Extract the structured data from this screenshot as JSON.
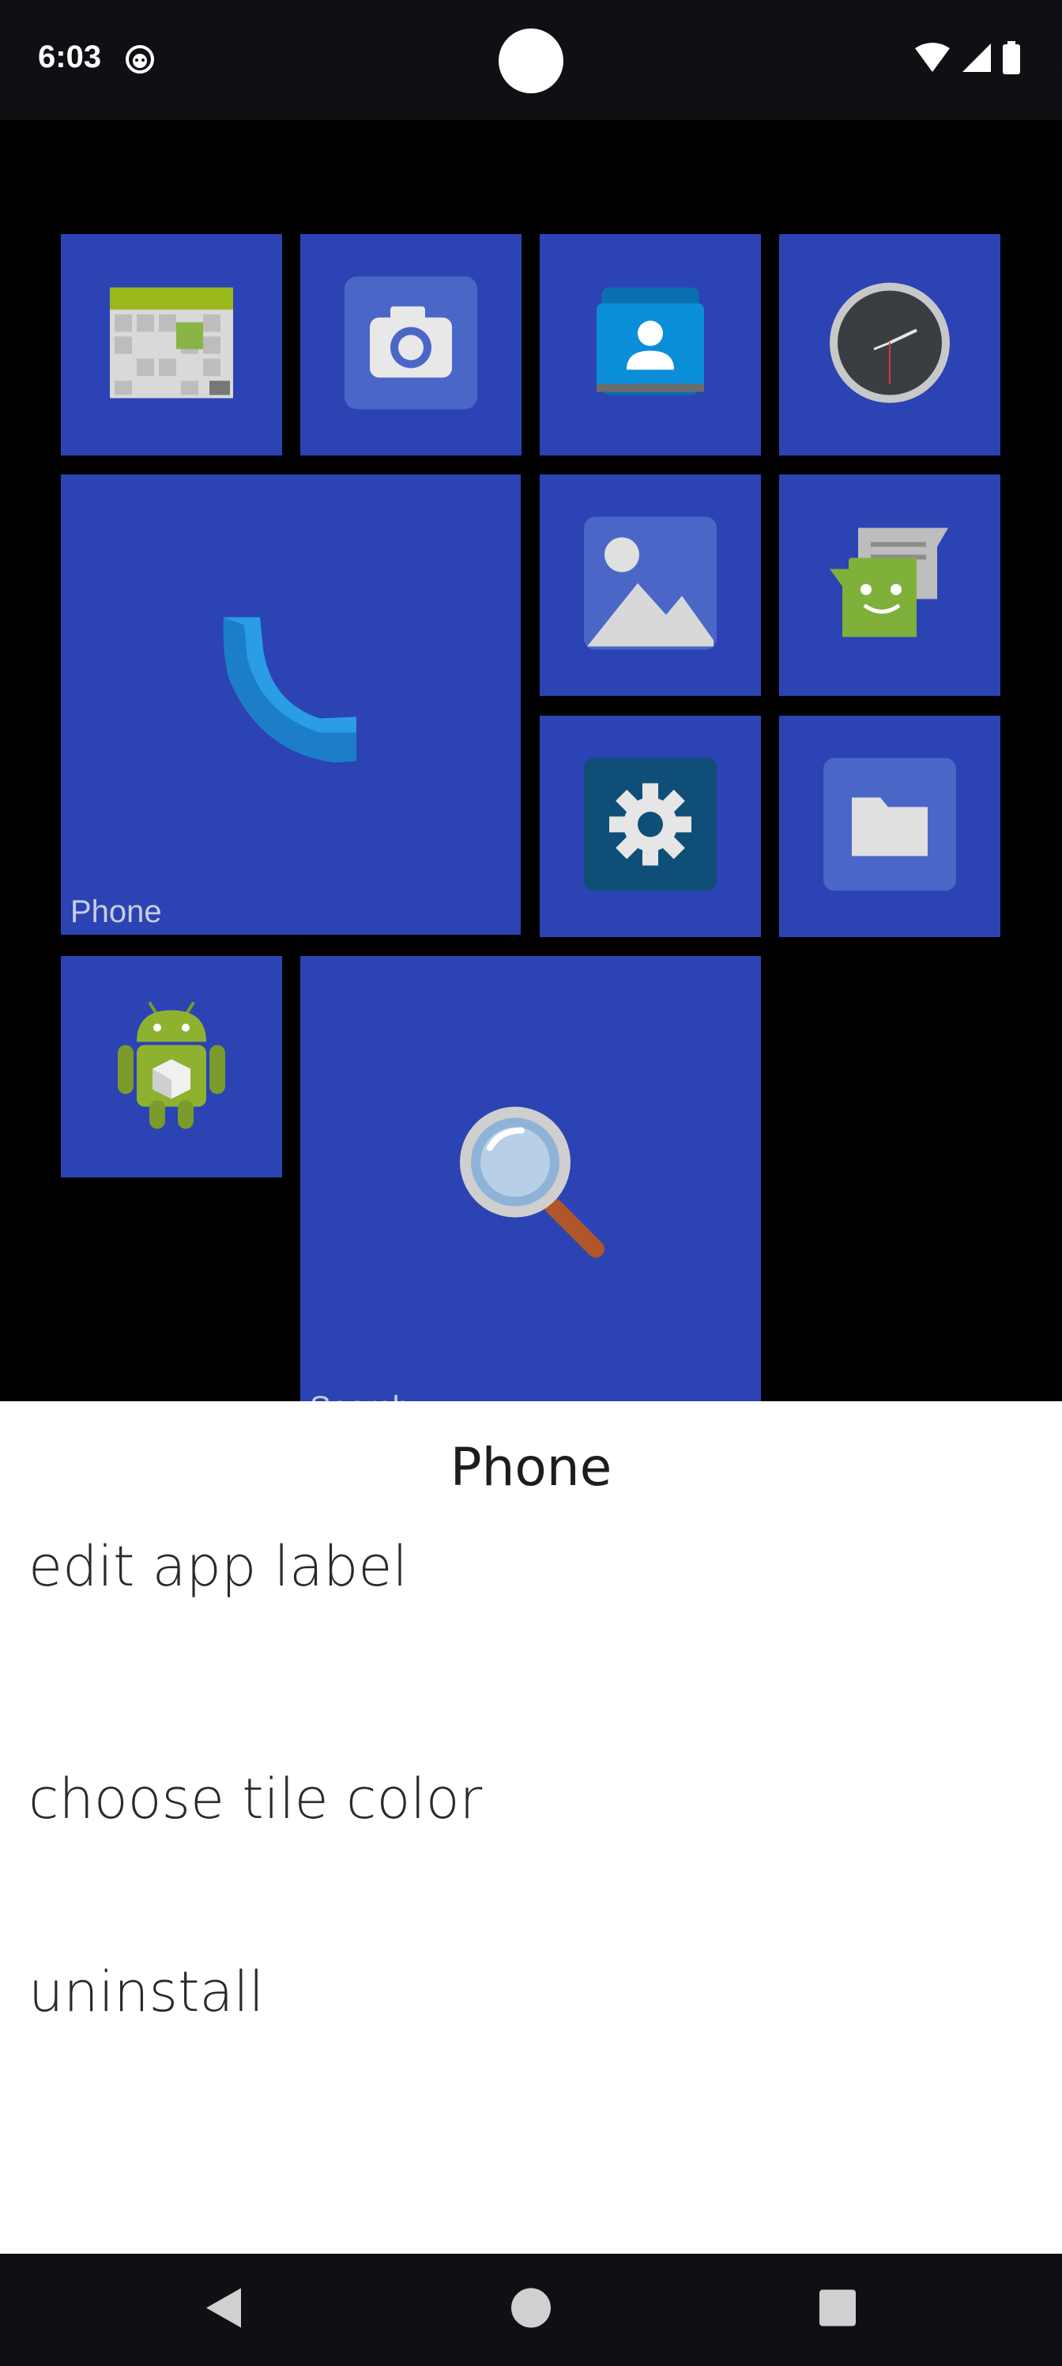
{
  "status_bar": {
    "time": "6:03"
  },
  "tiles": [
    {
      "id": "calendar",
      "icon": "calendar-icon",
      "label": ""
    },
    {
      "id": "camera",
      "icon": "camera-icon",
      "label": ""
    },
    {
      "id": "contacts",
      "icon": "contacts-icon",
      "label": ""
    },
    {
      "id": "clock",
      "icon": "clock-icon",
      "label": ""
    },
    {
      "id": "phone",
      "icon": "phone-icon",
      "label": "Phone"
    },
    {
      "id": "gallery",
      "icon": "gallery-icon",
      "label": ""
    },
    {
      "id": "messages",
      "icon": "messages-icon",
      "label": ""
    },
    {
      "id": "settings",
      "icon": "gear-icon",
      "label": ""
    },
    {
      "id": "files",
      "icon": "folder-icon",
      "label": ""
    },
    {
      "id": "android",
      "icon": "android-icon",
      "label": ""
    },
    {
      "id": "search",
      "icon": "magnifier-icon",
      "label": "Search"
    }
  ],
  "sheet": {
    "title": "Phone",
    "items": [
      "edit app label",
      "choose tile color",
      "uninstall"
    ]
  },
  "colors": {
    "tile": "#2c43b3",
    "background": "#000000",
    "bars": "#0e1013",
    "sheet": "#ffffff"
  }
}
